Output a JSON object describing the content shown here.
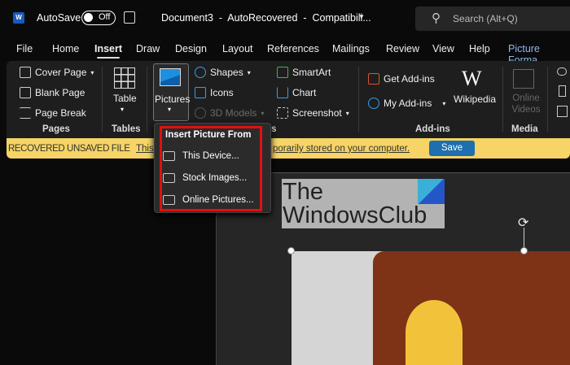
{
  "titlebar": {
    "app_icon": "W",
    "autosave_label": "AutoSave",
    "autosave_state": "Off",
    "doc_title": "Document3  -  AutoRecovered  -  Compatibili...",
    "search_placeholder": "Search (Alt+Q)"
  },
  "tabs": [
    "File",
    "Home",
    "Insert",
    "Draw",
    "Design",
    "Layout",
    "References",
    "Mailings",
    "Review",
    "View",
    "Help",
    "Picture Forma"
  ],
  "ribbon": {
    "pages": {
      "label": "Pages",
      "items": [
        "Cover Page",
        "Blank Page",
        "Page Break"
      ]
    },
    "tables": {
      "label": "Tables",
      "table": "Table"
    },
    "illustrations": {
      "label": "s",
      "pictures": "Pictures",
      "shapes": "Shapes",
      "icons": "Icons",
      "models": "3D Models",
      "smartart": "SmartArt",
      "chart": "Chart",
      "screenshot": "Screenshot"
    },
    "addins": {
      "label": "Add-ins",
      "get": "Get Add-ins",
      "my": "My Add-ins",
      "wikipedia": "Wikipedia",
      "wiki_logo": "W"
    },
    "media": {
      "label": "Media",
      "online_videos": "Online Videos"
    }
  },
  "banner": {
    "label": "RECOVERED UNSAVED FILE",
    "link_start": "This",
    "link_end": "porarily stored on your computer.",
    "save": "Save"
  },
  "menu": {
    "title": "Insert Picture From",
    "items": [
      "This Device...",
      "Stock Images...",
      "Online Pictures..."
    ]
  },
  "document": {
    "logo_line1": "The",
    "logo_line2": "WindowsClub"
  },
  "colors": {
    "accent": "#1d6fb0",
    "banner": "#f6d465",
    "highlight": "#e01010"
  }
}
